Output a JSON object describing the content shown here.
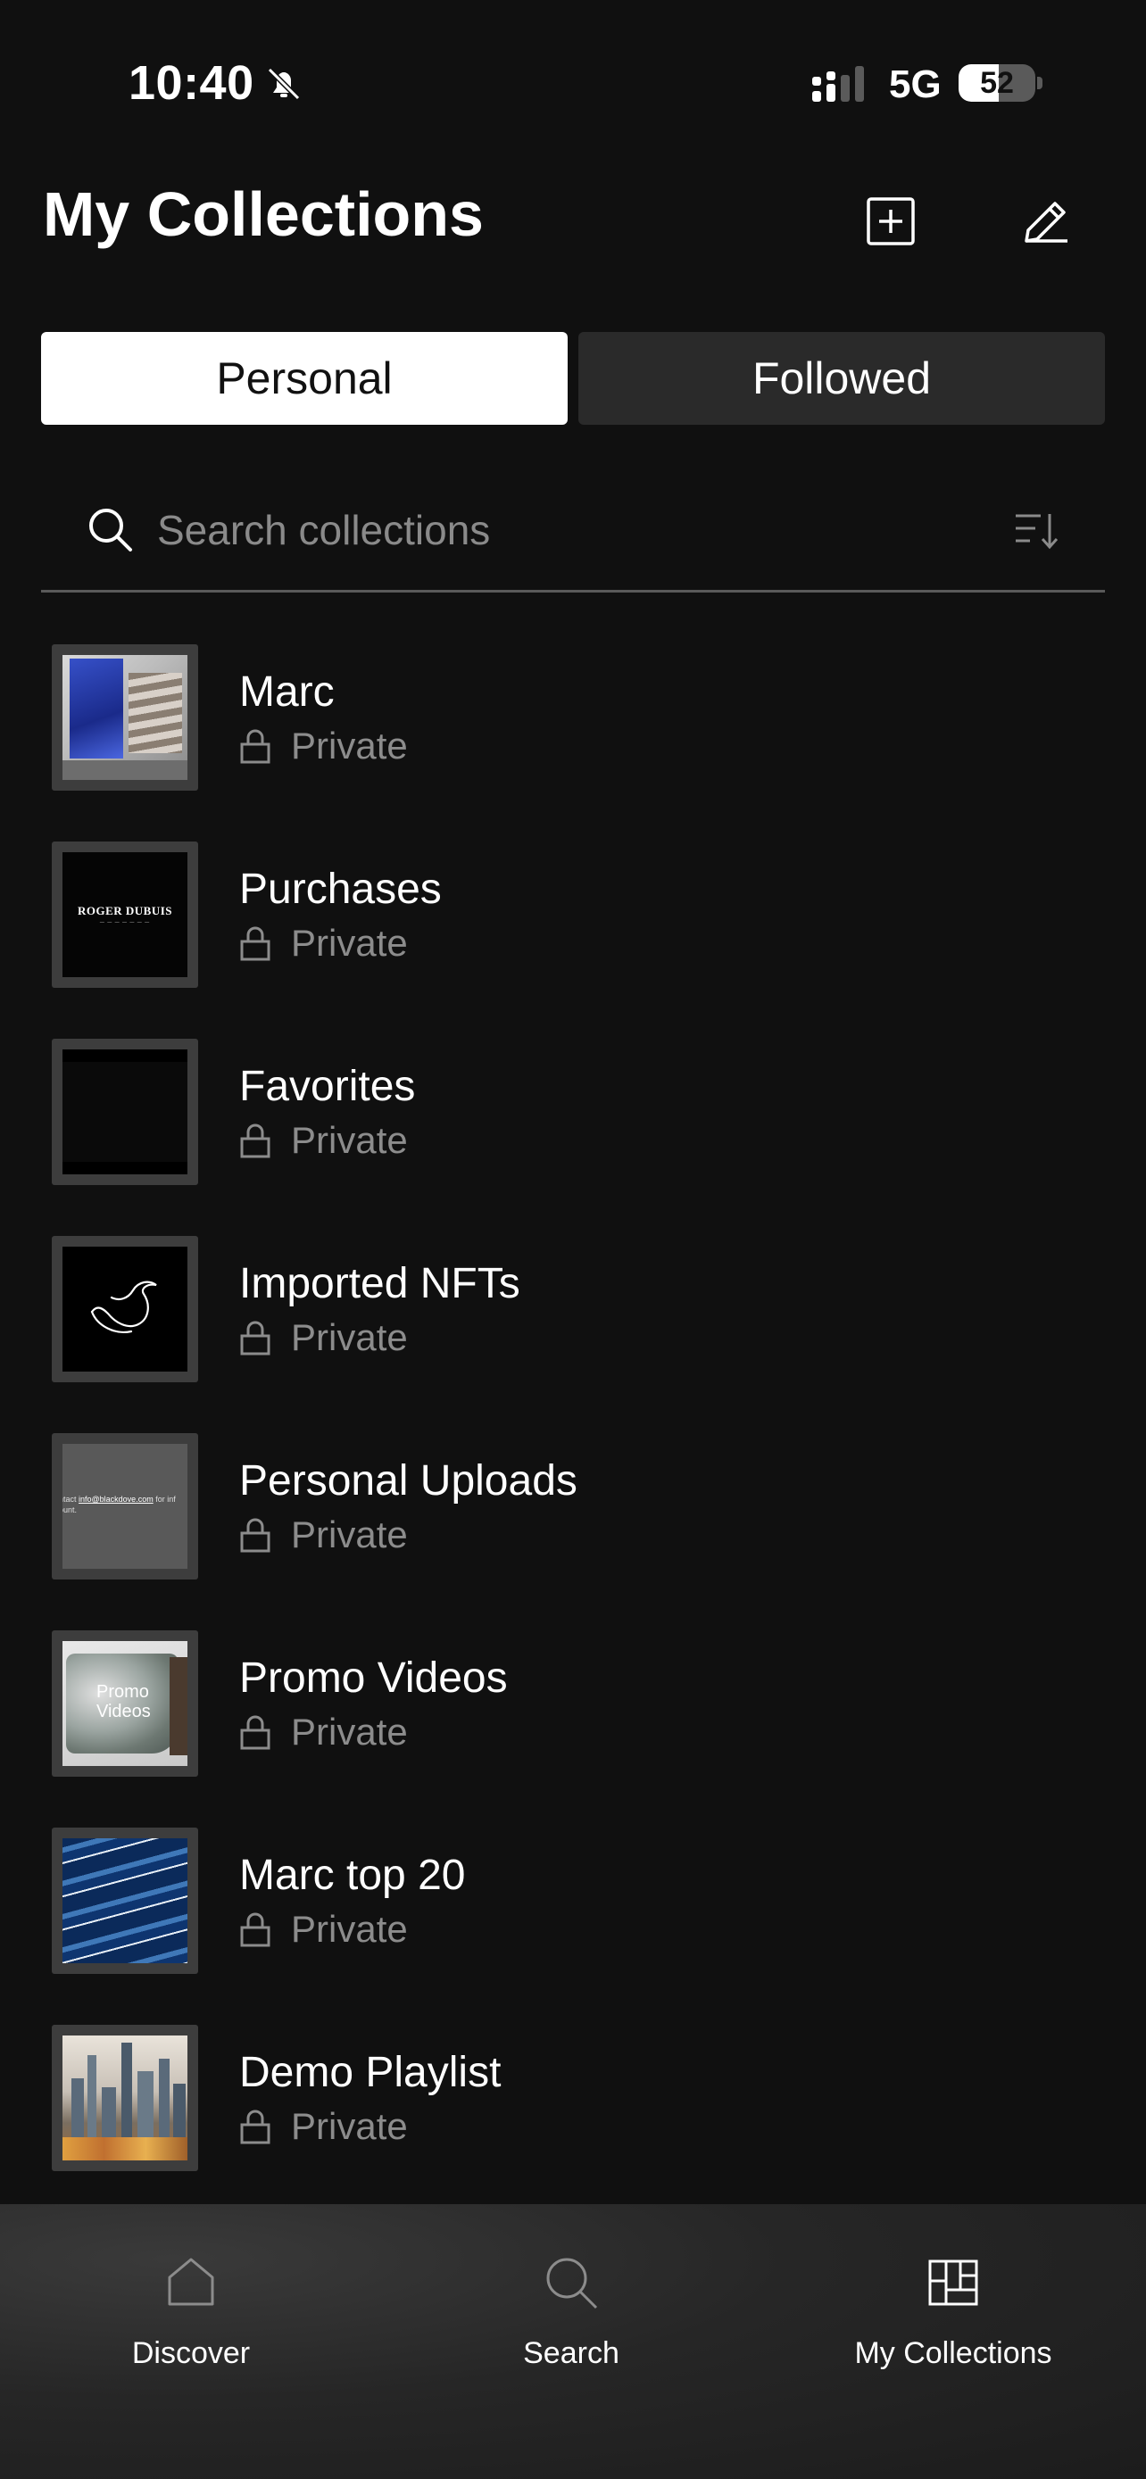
{
  "status_bar": {
    "time": "10:40",
    "network": "5G",
    "battery": "52",
    "battery_level": 0.52
  },
  "header": {
    "title": "My Collections",
    "add_icon": "plus-square-icon",
    "edit_icon": "pencil-icon"
  },
  "tabs": [
    {
      "label": "Personal",
      "active": true
    },
    {
      "label": "Followed",
      "active": false
    }
  ],
  "search": {
    "placeholder": "Search collections",
    "value": ""
  },
  "collections": [
    {
      "title": "Marc",
      "status": "Private"
    },
    {
      "title": "Purchases",
      "status": "Private",
      "thumb_text": "ROGER DUBUIS"
    },
    {
      "title": "Favorites",
      "status": "Private"
    },
    {
      "title": "Imported NFTs",
      "status": "Private"
    },
    {
      "title": "Personal Uploads",
      "status": "Private",
      "thumb_text_1": "ntact ",
      "thumb_link": "info@blackdove.com",
      "thumb_text_2": " for inf",
      "thumb_text_3": "ount."
    },
    {
      "title": "Promo Videos",
      "status": "Private",
      "thumb_text_1": "Promo",
      "thumb_text_2": "Videos"
    },
    {
      "title": "Marc top 20",
      "status": "Private"
    },
    {
      "title": "Demo Playlist",
      "status": "Private"
    }
  ],
  "bottom_nav": [
    {
      "label": "Discover",
      "icon": "home-icon",
      "active": false
    },
    {
      "label": "Search",
      "icon": "search-icon",
      "active": false
    },
    {
      "label": "My Collections",
      "icon": "collections-grid-icon",
      "active": true
    }
  ],
  "colors": {
    "background": "#101010",
    "tab_active": "#ffffff",
    "tab_inactive": "#2a2a2a",
    "muted_text": "#8c8c8c"
  }
}
